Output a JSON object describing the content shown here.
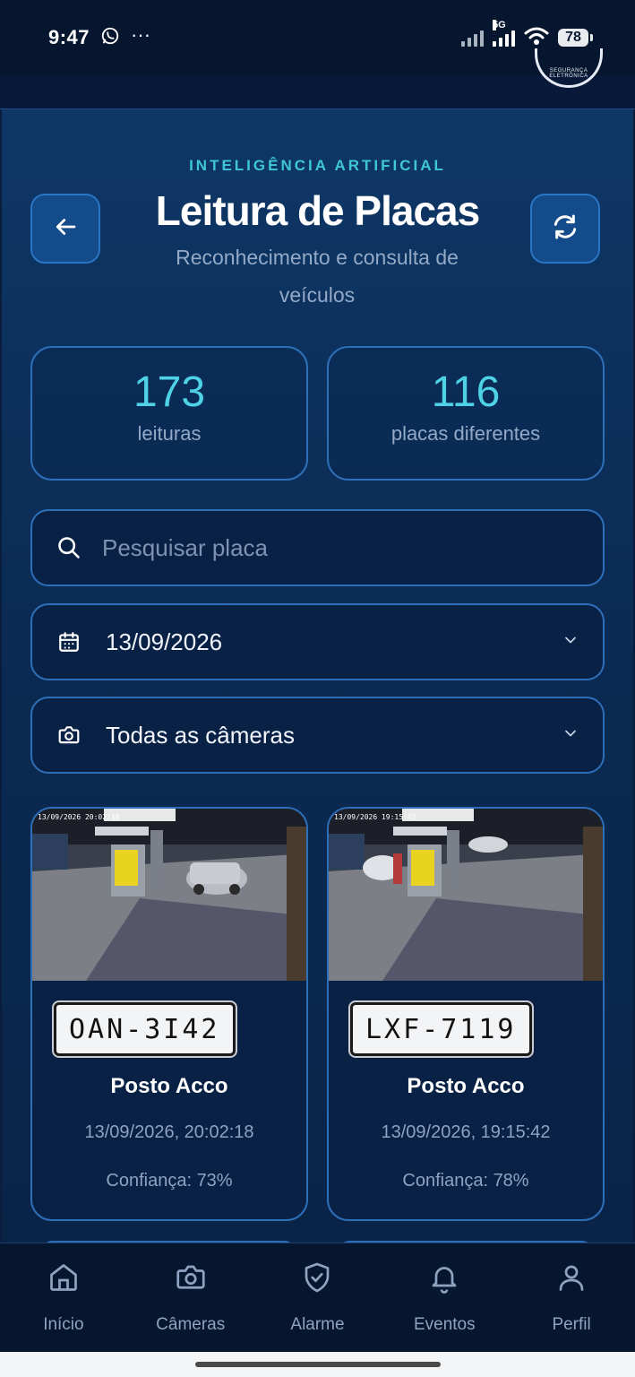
{
  "status_bar": {
    "time": "9:47",
    "network_label": "5G",
    "battery": "78"
  },
  "header": {
    "kicker": "INTELIGÊNCIA ARTIFICIAL",
    "title": "Leitura de Placas",
    "subtitle": "Reconhecimento e consulta de veículos",
    "back_icon": "arrow-left-icon",
    "refresh_icon": "refresh-icon"
  },
  "stats": [
    {
      "value": "173",
      "label": "leituras"
    },
    {
      "value": "116",
      "label": "placas diferentes"
    }
  ],
  "search": {
    "placeholder": "Pesquisar placa",
    "value": ""
  },
  "date_filter": {
    "value": "13/09/2026"
  },
  "camera_filter": {
    "value": "Todas as câmeras"
  },
  "readings": [
    {
      "plate": "OAN-3I42",
      "place": "Posto Acco",
      "timestamp": "13/09/2026, 20:02:18",
      "confidence": "Confiança: 73%"
    },
    {
      "plate": "LXF-7119",
      "place": "Posto Acco",
      "timestamp": "13/09/2026, 19:15:42",
      "confidence": "Confiança: 78%"
    }
  ],
  "bottom_nav": [
    {
      "label": "Início",
      "icon": "home-icon"
    },
    {
      "label": "Câmeras",
      "icon": "camera-icon"
    },
    {
      "label": "Alarme",
      "icon": "shield-check-icon"
    },
    {
      "label": "Eventos",
      "icon": "bell-icon"
    },
    {
      "label": "Perfil",
      "icon": "user-icon"
    }
  ],
  "colors": {
    "accent_cyan": "#4fd2e6",
    "card_border": "#2d6fb8",
    "background": "#0b2b54",
    "muted_text": "#8ea3c0"
  }
}
